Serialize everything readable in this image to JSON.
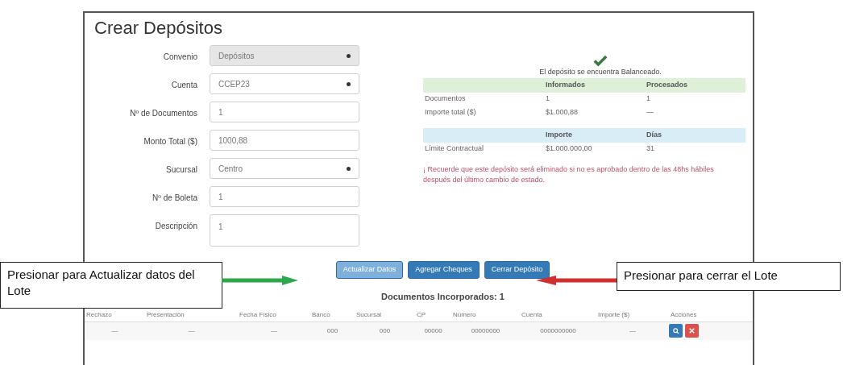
{
  "title": "Crear Depósitos",
  "form": {
    "fields": [
      {
        "label": "Convenio",
        "value": "Depósitos",
        "kind": "select",
        "disabled": true
      },
      {
        "label": "Cuenta",
        "value": "CCEP23",
        "kind": "select",
        "disabled": false
      },
      {
        "label": "Nº de Documentos",
        "value": "1",
        "kind": "input",
        "disabled": false
      },
      {
        "label": "Monto Total ($)",
        "value": "1000,88",
        "kind": "input",
        "disabled": false
      },
      {
        "label": "Sucursal",
        "value": "Centro",
        "kind": "select",
        "disabled": false
      },
      {
        "label": "Nº de Boleta",
        "value": "1",
        "kind": "input",
        "disabled": false
      },
      {
        "label": "Descripción",
        "value": "1",
        "kind": "textarea",
        "disabled": false
      }
    ]
  },
  "status": {
    "message": "El depósito se encuentra Balanceado."
  },
  "balance_table": {
    "columns": [
      "",
      "Informados",
      "Procesados"
    ],
    "rows": [
      [
        "Documentos",
        "1",
        "1"
      ],
      [
        "Importe total ($)",
        "$1.000,88",
        "—"
      ]
    ]
  },
  "limit_table": {
    "columns": [
      "",
      "Importe",
      "Días"
    ],
    "rows": [
      [
        "Límite Contractual",
        "$1.000.000,00",
        "31"
      ]
    ]
  },
  "note": "¡ Recuerde que este depósito será eliminado si no es aprobado dentro de las 48hs hábiles después del último cambio de estado.",
  "buttons": [
    {
      "label": "Actualizar Datos",
      "disabled": true
    },
    {
      "label": "Agregar Cheques",
      "disabled": false
    },
    {
      "label": "Cerrar Depósito",
      "disabled": false
    }
  ],
  "callouts": [
    {
      "text": "Presionar para Actualizar datos del Lote"
    },
    {
      "text": "Presionar para cerrar el Lote"
    }
  ],
  "documents": {
    "heading": "Documentos Incorporados: 1",
    "columns": [
      "Rechazo",
      "Presentación",
      "Fecha Físico",
      "Banco",
      "Sucursal",
      "CP",
      "Número",
      "Cuenta",
      "Importe ($)",
      "Acciones"
    ],
    "rows": [
      [
        "—",
        "—",
        "—",
        "000",
        "000",
        "00000",
        "00000000",
        "0000000000",
        "—"
      ]
    ]
  }
}
